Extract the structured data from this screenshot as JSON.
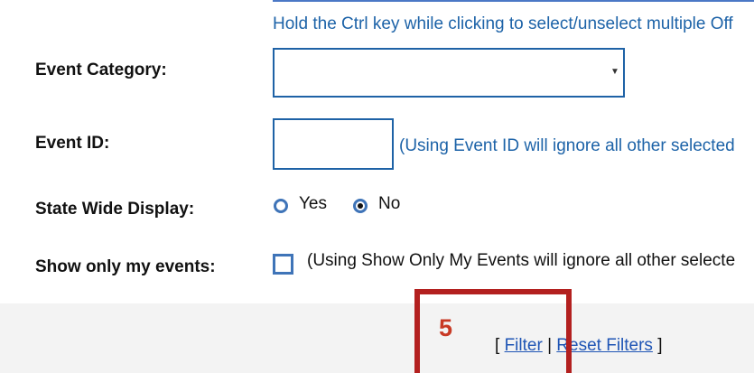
{
  "top_hint": "Hold the Ctrl key while clicking to select/unselect multiple Off",
  "event_category": {
    "label": "Event Category:",
    "value": ""
  },
  "event_id": {
    "label": "Event ID:",
    "value": "",
    "note": "(Using Event ID will ignore all other selected"
  },
  "statewide_display": {
    "label": "State Wide Display:",
    "options": [
      "Yes",
      "No"
    ],
    "selected": "No"
  },
  "my_events": {
    "label": "Show only my events:",
    "note": "(Using Show Only My Events will ignore all other selecte",
    "checked": false
  },
  "footer": {
    "open_bracket": "[ ",
    "filter": "Filter",
    "separator": " | ",
    "reset": "Reset Filters",
    "close_bracket": " ]"
  },
  "annotation": {
    "number": "5",
    "color": "#b3201f"
  }
}
